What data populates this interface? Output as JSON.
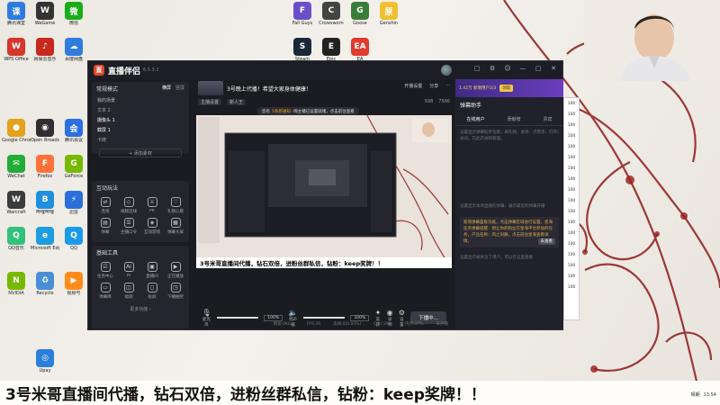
{
  "desktop": {
    "icons": [
      {
        "label": "腾讯课堂",
        "color": "#2d7be0",
        "glyph": "课"
      },
      {
        "label": "WeGame",
        "color": "#333",
        "glyph": "W"
      },
      {
        "label": "微信",
        "color": "#1aad19",
        "glyph": "微"
      },
      {
        "label": "Fall Guys",
        "color": "#6a4fc9",
        "glyph": "F"
      },
      {
        "label": "Crowsworn",
        "color": "#444",
        "glyph": "C"
      },
      {
        "label": "Goose",
        "color": "#3a7d3a",
        "glyph": "G"
      },
      {
        "label": "Genshin",
        "color": "#f0c030",
        "glyph": "原"
      },
      {
        "label": "WPS Office",
        "color": "#d6372a",
        "glyph": "W"
      },
      {
        "label": "网易云音乐",
        "color": "#c9281e",
        "glyph": "♪"
      },
      {
        "label": "百度网盘",
        "color": "#2f7bde",
        "glyph": "☁"
      },
      {
        "label": "Steam",
        "color": "#1b2838",
        "glyph": "S"
      },
      {
        "label": "Epic",
        "color": "#222",
        "glyph": "E"
      },
      {
        "label": "EA",
        "color": "#e23a2c",
        "glyph": "EA"
      },
      {
        "label": "Google Chrome",
        "color": "#e1a21c",
        "glyph": "●"
      },
      {
        "label": "Open Broadcaster",
        "color": "#302e31",
        "glyph": "◉"
      },
      {
        "label": "腾讯会议",
        "color": "#2b6fe3",
        "glyph": "会"
      },
      {
        "label": "WeChat",
        "color": "#22ac38",
        "glyph": "✉"
      },
      {
        "label": "Firefox",
        "color": "#ff7139",
        "glyph": "F"
      },
      {
        "label": "GeForce",
        "color": "#76b900",
        "glyph": "G"
      },
      {
        "label": "Warcraft",
        "color": "#3c3c3c",
        "glyph": "W"
      },
      {
        "label": "哔哩哔哩",
        "color": "#1f8fe0",
        "glyph": "B"
      },
      {
        "label": "迅雷",
        "color": "#2a6fdb",
        "glyph": "⚡"
      },
      {
        "label": "QQ音乐",
        "color": "#31c27c",
        "glyph": "Q"
      },
      {
        "label": "Microsoft Edge",
        "color": "#1e9de0",
        "glyph": "e"
      },
      {
        "label": "QQ",
        "color": "#1a9be8",
        "glyph": "Q"
      },
      {
        "label": "NVIDIA",
        "color": "#76b900",
        "glyph": "N"
      },
      {
        "label": "Recycle",
        "color": "#4a8fd6",
        "glyph": "♻"
      },
      {
        "label": "视频号",
        "color": "#ff8c1a",
        "glyph": "▶"
      },
      {
        "label": "Upay",
        "color": "#2a7fd8",
        "glyph": "◎"
      }
    ]
  },
  "app": {
    "name": "直播伴侣",
    "version": "6.5.3.2",
    "window_controls": [
      "▢",
      "⚙",
      "☺",
      "—",
      "▢",
      "✕"
    ]
  },
  "left_panel": {
    "mode_title": "常规模式",
    "mode_tabs": [
      {
        "label": "横屏",
        "active": true
      },
      {
        "label": "竖屏",
        "active": false
      }
    ],
    "scene_header": "我的场景",
    "scenes": [
      {
        "label": "文本 2",
        "selected": false
      },
      {
        "label": "摄像头 1",
        "selected": true
      },
      {
        "label": "截屏 1",
        "selected": true
      },
      {
        "label": "卡牌",
        "selected": false
      }
    ],
    "add_source": "+ 添加素材",
    "interact_title": "互动玩法",
    "interact_tools": [
      {
        "label": "连线",
        "glyph": "⇄"
      },
      {
        "label": "视频连线",
        "glyph": "◇"
      },
      {
        "label": "PK",
        "glyph": "⚔"
      },
      {
        "label": "礼物心愿",
        "glyph": "♡"
      },
      {
        "label": "弹幕",
        "glyph": "▤"
      },
      {
        "label": "主播口令",
        "glyph": "☰"
      },
      {
        "label": "互动游戏",
        "glyph": "◈"
      },
      {
        "label": "弹幕大屏",
        "glyph": "▦"
      }
    ],
    "basic_title": "基础工具",
    "basic_tools": [
      {
        "label": "任务中心",
        "glyph": "☑"
      },
      {
        "label": "AI",
        "glyph": "AI"
      },
      {
        "label": "直播间",
        "glyph": "▣"
      },
      {
        "label": "正在播放",
        "glyph": "▶"
      },
      {
        "label": "弹幕库",
        "glyph": "▭"
      },
      {
        "label": "福袋",
        "glyph": "◫"
      },
      {
        "label": "投屏",
        "glyph": "◻"
      },
      {
        "label": "下播抽奖",
        "glyph": "◳"
      }
    ],
    "more": "更多功能 ›"
  },
  "center": {
    "stream_title": "3号晚上代播！希望大家身体健康！",
    "top_actions": [
      "开播设置",
      "分享",
      "···"
    ],
    "sub_tags": [
      "主播设置",
      "新人王"
    ],
    "stats": [
      "598",
      "7566"
    ],
    "notice_prefix": "您有",
    "notice_highlight": "1条新通知",
    "notice_suffix": "·嗨主播已设置就绪，点击前往查看",
    "preview_banner": "3号米哥直播间代播，钻石双倍，进粉丝群私信，钻粉：keep奖牌！！",
    "controls": {
      "mic_label": "麦克风",
      "mic_pct": "100%",
      "mic_level": 1.0,
      "speaker_label": "扬声器",
      "speaker_pct": "100%",
      "speaker_level": 1.0,
      "tools": [
        "美颜",
        "录制",
        "设置"
      ],
      "live_button": "下播中..."
    },
    "status": [
      "网速:0Kb/s",
      "FPS:30",
      "丢帧:0(0.00%)",
      "CPU:29%",
      "内存:37%",
      "未开播"
    ]
  },
  "right_panel": {
    "banner_text": "1.42万 新增用户2/3",
    "banner_badge": "领取",
    "title": "弹幕助手",
    "tabs": [
      {
        "label": "在线用户",
        "active": true
      },
      {
        "label": "贡献榜",
        "active": false
      },
      {
        "label": "贵宾",
        "active": false
      }
    ],
    "hint1": "设置显示弹幕助手功能，如礼物、进场、点赞等，打开/关闭，在此开关和管理。",
    "hint2": "设置显示本场直播的弹幕，展示最近的弹幕开播",
    "task_box": "新增弹幕面板功能，点击弹幕区域进行设置。星海任务弹幕提醒：想让你的粉丝在星海平台参加的任务，产品名称：风之剑舞，点击前往星海查看详情。",
    "task_view": "去查看",
    "hint3": "设置显示被关注了用户，可以在这里查看",
    "side_counts": [
      "100",
      "100",
      "100",
      "100",
      "100",
      "100",
      "100",
      "100",
      "100",
      "100",
      "100",
      "100",
      "100",
      "100",
      "100",
      "100",
      "100",
      "100"
    ]
  },
  "caption": "3号米哥直播间代播，钻石双倍，进粉丝群私信，钻粉：keep奖牌！！",
  "taskbar": {
    "tray_label": "晴朗",
    "time": "13:54"
  },
  "colors": {
    "accent": "#e2462c",
    "panel": "#1b1c22",
    "banner": "#6b3ec0"
  }
}
